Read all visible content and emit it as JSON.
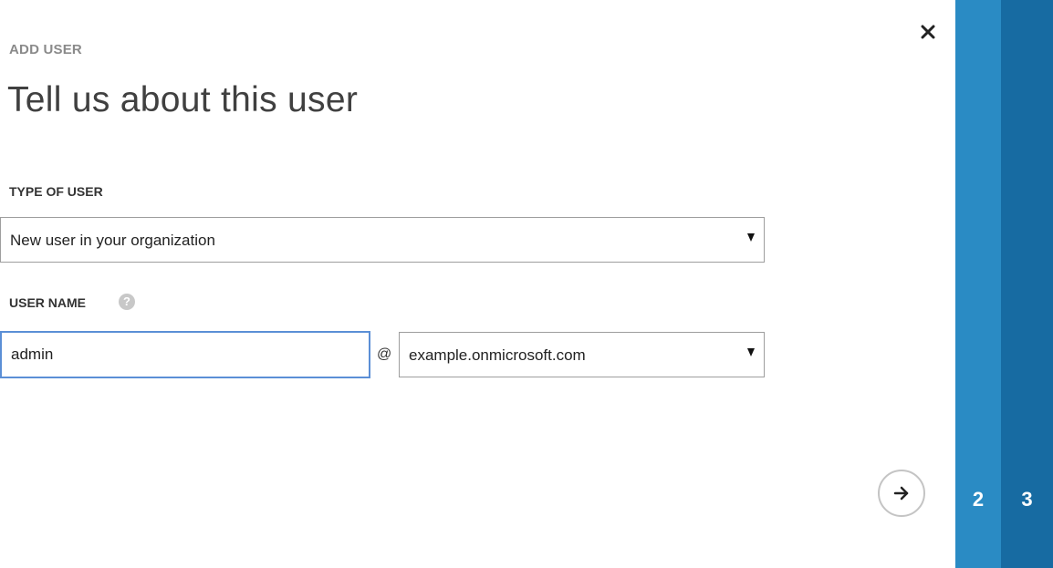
{
  "header": {
    "eyebrow": "ADD USER",
    "title": "Tell us about this user"
  },
  "type_of_user": {
    "label": "TYPE OF USER",
    "selected": "New user in your organization"
  },
  "user_name": {
    "label": "USER NAME",
    "help_glyph": "?",
    "value": "admin",
    "at_symbol": "@",
    "domain_selected": "example.onmicrosoft.com"
  },
  "wizard": {
    "steps": [
      {
        "label": "2"
      },
      {
        "label": "3"
      }
    ]
  },
  "icons": {
    "close": "close-icon",
    "next": "arrow-right-icon",
    "help": "question-mark-icon",
    "dropdown": "chevron-down-icon"
  },
  "colors": {
    "step_2_bg": "#2a8bc4",
    "step_3_bg": "#176ba2",
    "input_focus_border": "#5b8fd6"
  }
}
